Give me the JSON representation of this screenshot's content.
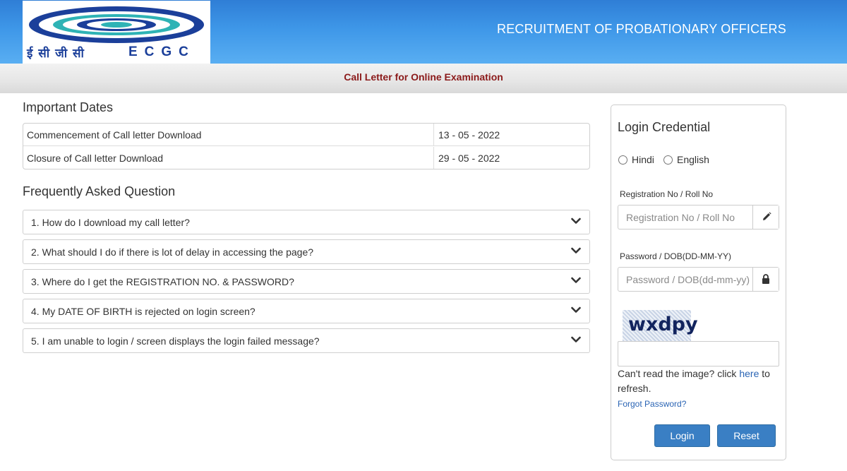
{
  "header": {
    "logo_hindi": "ई सी जी सी",
    "logo_text": "ECGC",
    "site_title": "RECRUITMENT OF PROBATIONARY OFFICERS"
  },
  "subheader": {
    "title": "Call Letter for Online Examination"
  },
  "important_dates": {
    "heading": "Important Dates",
    "rows": [
      {
        "label": "Commencement of Call letter Download",
        "date": "13 - 05 - 2022"
      },
      {
        "label": "Closure of Call letter Download",
        "date": "29 - 05 - 2022"
      }
    ]
  },
  "faq": {
    "heading": "Frequently Asked Question",
    "items": [
      "1. How do I download my call letter?",
      "2. What should I do if there is lot of delay in accessing the page?",
      "3. Where do I get the REGISTRATION NO. & PASSWORD?",
      "4. My DATE OF BIRTH is rejected on login screen?",
      "5. I am unable to login / screen displays the login failed message?"
    ]
  },
  "login": {
    "title": "Login Credential",
    "languages": [
      "Hindi",
      "English"
    ],
    "registration_label": "Registration No / Roll No",
    "registration_placeholder": "Registration No / Roll No",
    "password_label": "Password / DOB(DD-MM-YY)",
    "password_placeholder": "Password / DOB(dd-mm-yy)",
    "captcha_text": "wxdpy",
    "refresh_prefix": "Can't read the image? click ",
    "refresh_link": "here",
    "refresh_suffix": " to refresh.",
    "forgot_password": "Forgot Password?",
    "login_button": "Login",
    "reset_button": "Reset"
  },
  "colors": {
    "header_blue": "#3e97e8",
    "subheader_title": "#8b1a1a",
    "button_blue": "#3a7fc4",
    "link_blue": "#2a64b4"
  },
  "icons": {
    "faq_toggle": "chevron-down-icon",
    "registration_addon": "pencil-icon",
    "password_addon": "lock-icon"
  }
}
